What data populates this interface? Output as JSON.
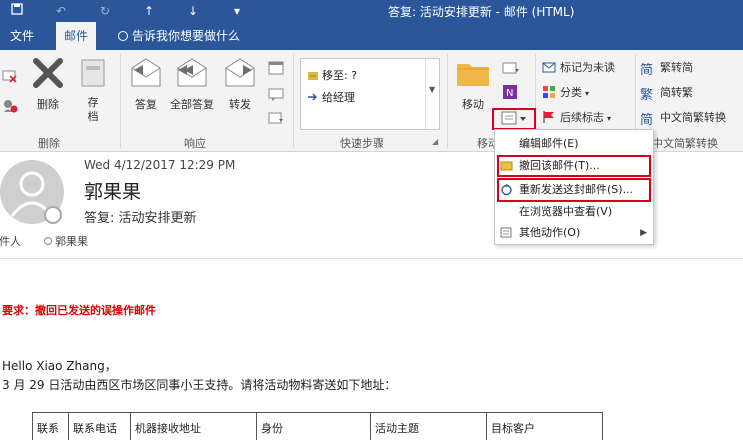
{
  "window": {
    "title": "答复: 活动安排更新 - 邮件 (HTML)"
  },
  "tabs": {
    "file": "文件",
    "message": "邮件",
    "tell_me": "告诉我你想要做什么"
  },
  "ribbon": {
    "delete_group": {
      "delete": "删除",
      "archive": "存档",
      "label": "删除"
    },
    "respond_group": {
      "reply": "答复",
      "reply_all": "全部答复",
      "forward": "转发",
      "label": "响应"
    },
    "quick_steps": {
      "move_to": "移至: ?",
      "to_manager": "给经理",
      "label": "快速步骤"
    },
    "move_group": {
      "move": "移动",
      "label": "移动"
    },
    "tags_group": {
      "mark_unread": "标记为未读",
      "categorize": "分类",
      "follow_up": "后续标志"
    },
    "chinese_group": {
      "to_traditional": "繁转简",
      "to_simplified": "简转繁",
      "convert": "中文简繁转换",
      "label": "中文简繁转换"
    }
  },
  "actions_menu": {
    "items": [
      {
        "label": "编辑邮件(E)"
      },
      {
        "label": "撤回该邮件(T)..."
      },
      {
        "label": "重新发送这封邮件(S)..."
      },
      {
        "label": "在浏览器中查看(V)"
      },
      {
        "label": "其他动作(O)"
      }
    ]
  },
  "message": {
    "datetime": "Wed 4/12/2017 12:29 PM",
    "sender": "郭果果",
    "subject": "答复: 活动安排更新",
    "recipient_label": "收件人",
    "recipient": "郭果果",
    "requirement": "要求：撤回已发送的误操作邮件",
    "greeting": "Hello Xiao Zhang，",
    "body_line": "3 月 29 日活动由西区市场区同事小王支持。请将活动物料寄送如下地址：",
    "table_headers": [
      "联系",
      "联系电话",
      "机器接收地址",
      "身份",
      "活动主题",
      "目标客户"
    ]
  },
  "colors": {
    "accent": "#2b579a",
    "highlight": "#d9001b",
    "requirement_text": "#e00000"
  }
}
